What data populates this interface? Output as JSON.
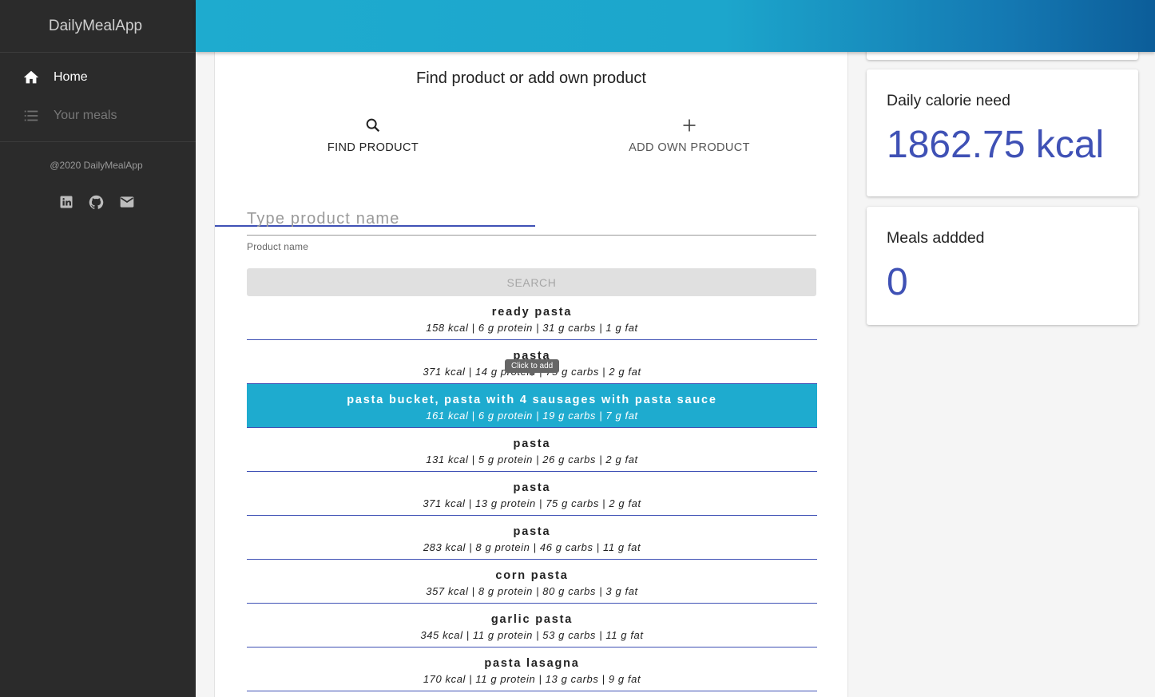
{
  "sidebar": {
    "brand": "DailyMealApp",
    "nav": [
      {
        "label": "Home",
        "icon": "home-icon",
        "active": true
      },
      {
        "label": "Your meals",
        "icon": "list-icon",
        "active": false
      }
    ],
    "copyright": "@2020 DailyMealApp",
    "socials": [
      "linkedin-icon",
      "github-icon",
      "mail-icon"
    ]
  },
  "main": {
    "title": "Find product or add own product",
    "tabs": [
      {
        "label": "FIND PRODUCT",
        "icon": "search-icon"
      },
      {
        "label": "ADD OWN PRODUCT",
        "icon": "plus-icon"
      }
    ],
    "search": {
      "placeholder": "Type product name",
      "helper": "Product name",
      "button": "SEARCH"
    },
    "tooltip": "Click to add",
    "results": [
      {
        "name": "ready pasta",
        "info": "158 kcal | 6 g protein | 31 g carbs | 1 g fat"
      },
      {
        "name": "pasta",
        "info": "371 kcal | 14 g protein | 75 g carbs | 2 g fat"
      },
      {
        "name": "pasta bucket, pasta with 4 sausages with pasta sauce",
        "info": "161 kcal | 6 g protein | 19 g carbs | 7 g fat"
      },
      {
        "name": "pasta",
        "info": "131 kcal | 5 g protein | 26 g carbs | 2 g fat"
      },
      {
        "name": "pasta",
        "info": "371 kcal | 13 g protein | 75 g carbs | 2 g fat"
      },
      {
        "name": "pasta",
        "info": "283 kcal | 8 g protein | 46 g carbs | 11 g fat"
      },
      {
        "name": "corn pasta",
        "info": "357 kcal | 8 g protein | 80 g carbs | 3 g fat"
      },
      {
        "name": "garlic pasta",
        "info": "345 kcal | 11 g protein | 53 g carbs | 11 g fat"
      },
      {
        "name": "pasta lasagna",
        "info": "170 kcal | 11 g protein | 13 g carbs | 9 g fat"
      }
    ]
  },
  "stats": {
    "calorie_label": "Daily calorie need",
    "calorie_value": "1862.75 kcal",
    "meals_label": "Meals addded",
    "meals_value": "0"
  },
  "colors": {
    "accent": "#3f51b5",
    "highlight": "#1eabcf",
    "sidebar_bg": "#2b2b2b"
  }
}
